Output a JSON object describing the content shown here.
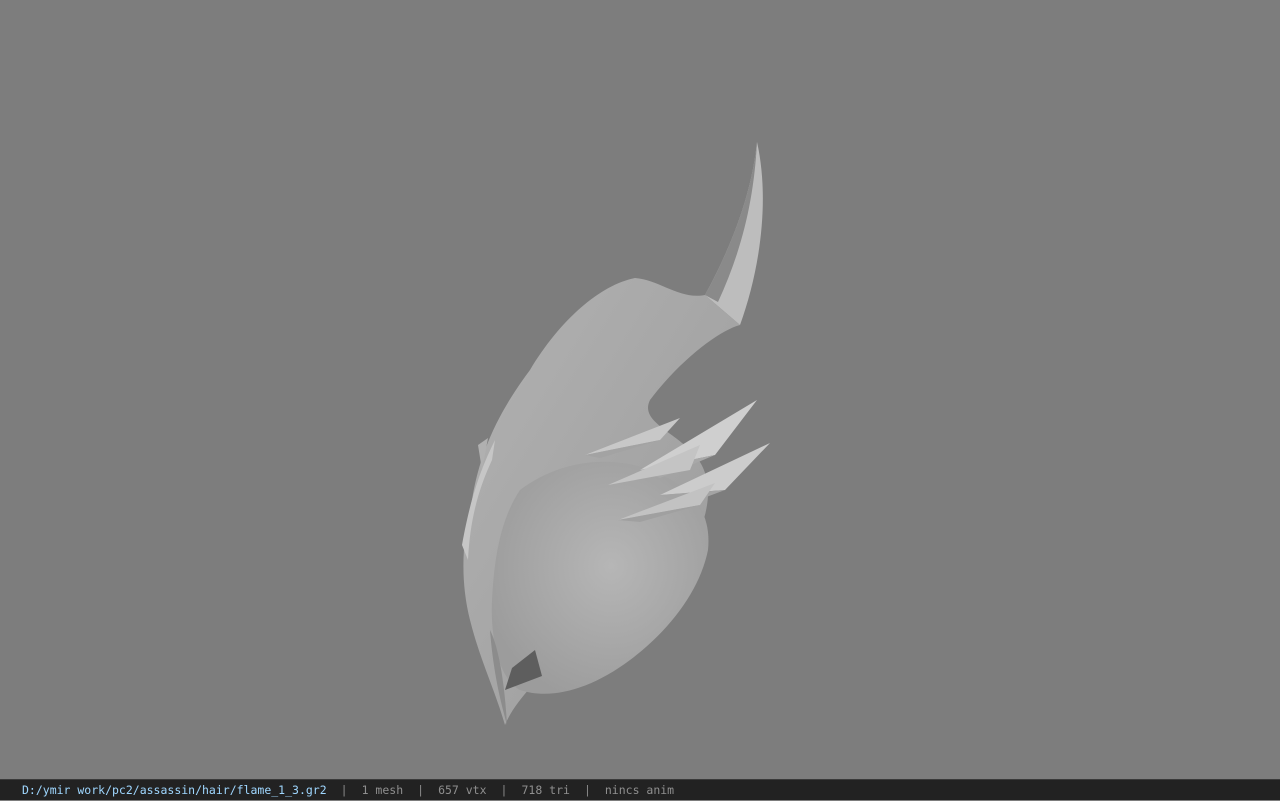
{
  "viewport": {
    "background_color": "#7d7d7d",
    "model_color": "#a9a9a9"
  },
  "status_bar": {
    "file_path": "D:/ymir work/pc2/assassin/hair/flame_1_3.gr2",
    "separator": "|",
    "mesh_count": "1 mesh",
    "vertex_count": "657 vtx",
    "triangle_count": "718 tri",
    "anim_label": "nincs anim",
    "path_color": "#9fd7ff",
    "text_color": "#8f8f8f"
  }
}
